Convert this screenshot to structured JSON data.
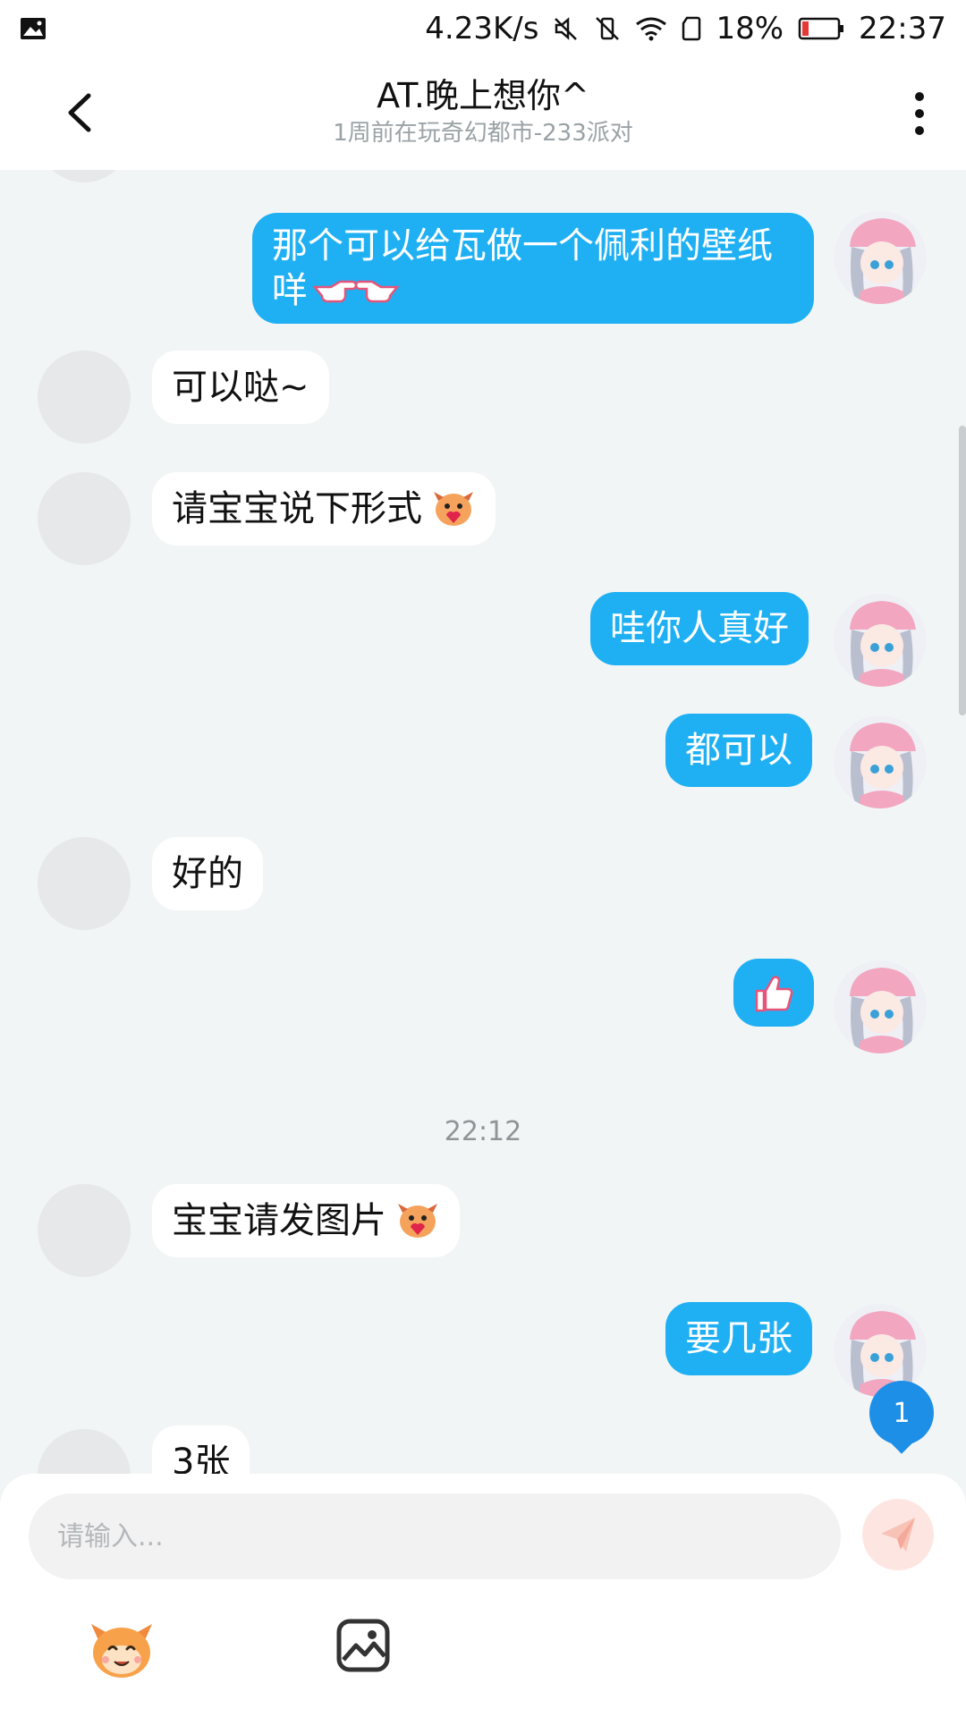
{
  "status_bar": {
    "net_speed": "4.23K/s",
    "battery_pct": "18%",
    "time": "22:37"
  },
  "header": {
    "title": "AT.晚上想你^",
    "subtitle": "1周前在玩奇幻都市-233派对"
  },
  "messages": [
    {
      "side": "out",
      "text": "那个可以给瓦做一个佩利的壁纸",
      "text2": "咩"
    },
    {
      "side": "in",
      "text": "可以哒~"
    },
    {
      "side": "in",
      "text": "请宝宝说下形式"
    },
    {
      "side": "out",
      "text": "哇你人真好"
    },
    {
      "side": "out",
      "text": "都可以"
    },
    {
      "side": "in",
      "text": "好的"
    },
    {
      "side": "out",
      "text": "thumbs-up sticker"
    },
    {
      "side": "in",
      "text": "宝宝请发图片"
    },
    {
      "side": "out",
      "text": "要几张"
    },
    {
      "side": "in",
      "text": "3张"
    }
  ],
  "timestamp": "22:12",
  "unread_count": "1",
  "input": {
    "placeholder": "请输入..."
  },
  "icons": {
    "back": "chevron-left-icon",
    "more": "more-vertical-icon",
    "send": "send-icon",
    "emoji": "emoji-icon",
    "image": "image-icon"
  },
  "colors": {
    "accent": "#1fb0f4",
    "badge": "#1e8fe6",
    "background": "#f2f5f5"
  }
}
